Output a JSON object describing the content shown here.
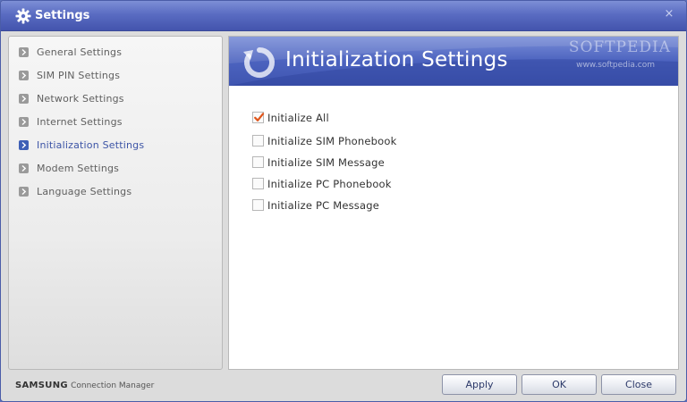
{
  "window": {
    "title": "Settings",
    "close_glyph": "×"
  },
  "sidebar": {
    "items": [
      {
        "label": "General Settings",
        "active": false
      },
      {
        "label": "SIM PIN Settings",
        "active": false
      },
      {
        "label": "Network Settings",
        "active": false
      },
      {
        "label": "Internet Settings",
        "active": false
      },
      {
        "label": "Initialization Settings",
        "active": true
      },
      {
        "label": "Modem Settings",
        "active": false
      },
      {
        "label": "Language Settings",
        "active": false
      }
    ]
  },
  "main": {
    "title": "Initialization Settings",
    "watermark": "SOFTPEDIA",
    "watermark_url": "www.softpedia.com",
    "options": [
      {
        "label": "Initialize All",
        "checked": true
      },
      {
        "label": "Initialize SIM Phonebook",
        "checked": false
      },
      {
        "label": "Initialize SIM Message",
        "checked": false
      },
      {
        "label": "Initialize PC Phonebook",
        "checked": false
      },
      {
        "label": "Initialize PC Message",
        "checked": false
      }
    ]
  },
  "footer": {
    "brand": "SAMSUNG",
    "product": "Connection Manager",
    "apply_label": "Apply",
    "ok_label": "OK",
    "close_label": "Close"
  },
  "colors": {
    "titlebar": "#5a6cc2",
    "banner": "#4c63bf",
    "active_nav": "#3c54a6",
    "check_mark": "#e0561c"
  },
  "icons": {
    "title": "gear-icon",
    "banner": "refresh-icon",
    "nav_bullet": "chevron-right-icon",
    "check": "check-icon"
  }
}
